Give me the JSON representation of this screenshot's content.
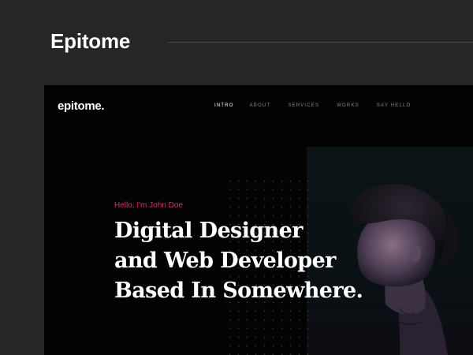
{
  "card": {
    "title": "Epitome"
  },
  "site": {
    "logo": "epitome.",
    "nav": [
      {
        "label": "INTRO",
        "active": true
      },
      {
        "label": "ABOUT",
        "active": false
      },
      {
        "label": "SERVICES",
        "active": false
      },
      {
        "label": "WORKS",
        "active": false
      },
      {
        "label": "SAY HELLO",
        "active": false
      }
    ],
    "hero": {
      "greeting": "Hello, I'm John Doe",
      "headline_lines": [
        "Digital Designer",
        "and Web Developer",
        "Based In Somewhere."
      ]
    }
  },
  "colors": {
    "background": "#262626",
    "preview_background": "#030303",
    "accent": "#d2346c",
    "text": "#ffffff"
  }
}
